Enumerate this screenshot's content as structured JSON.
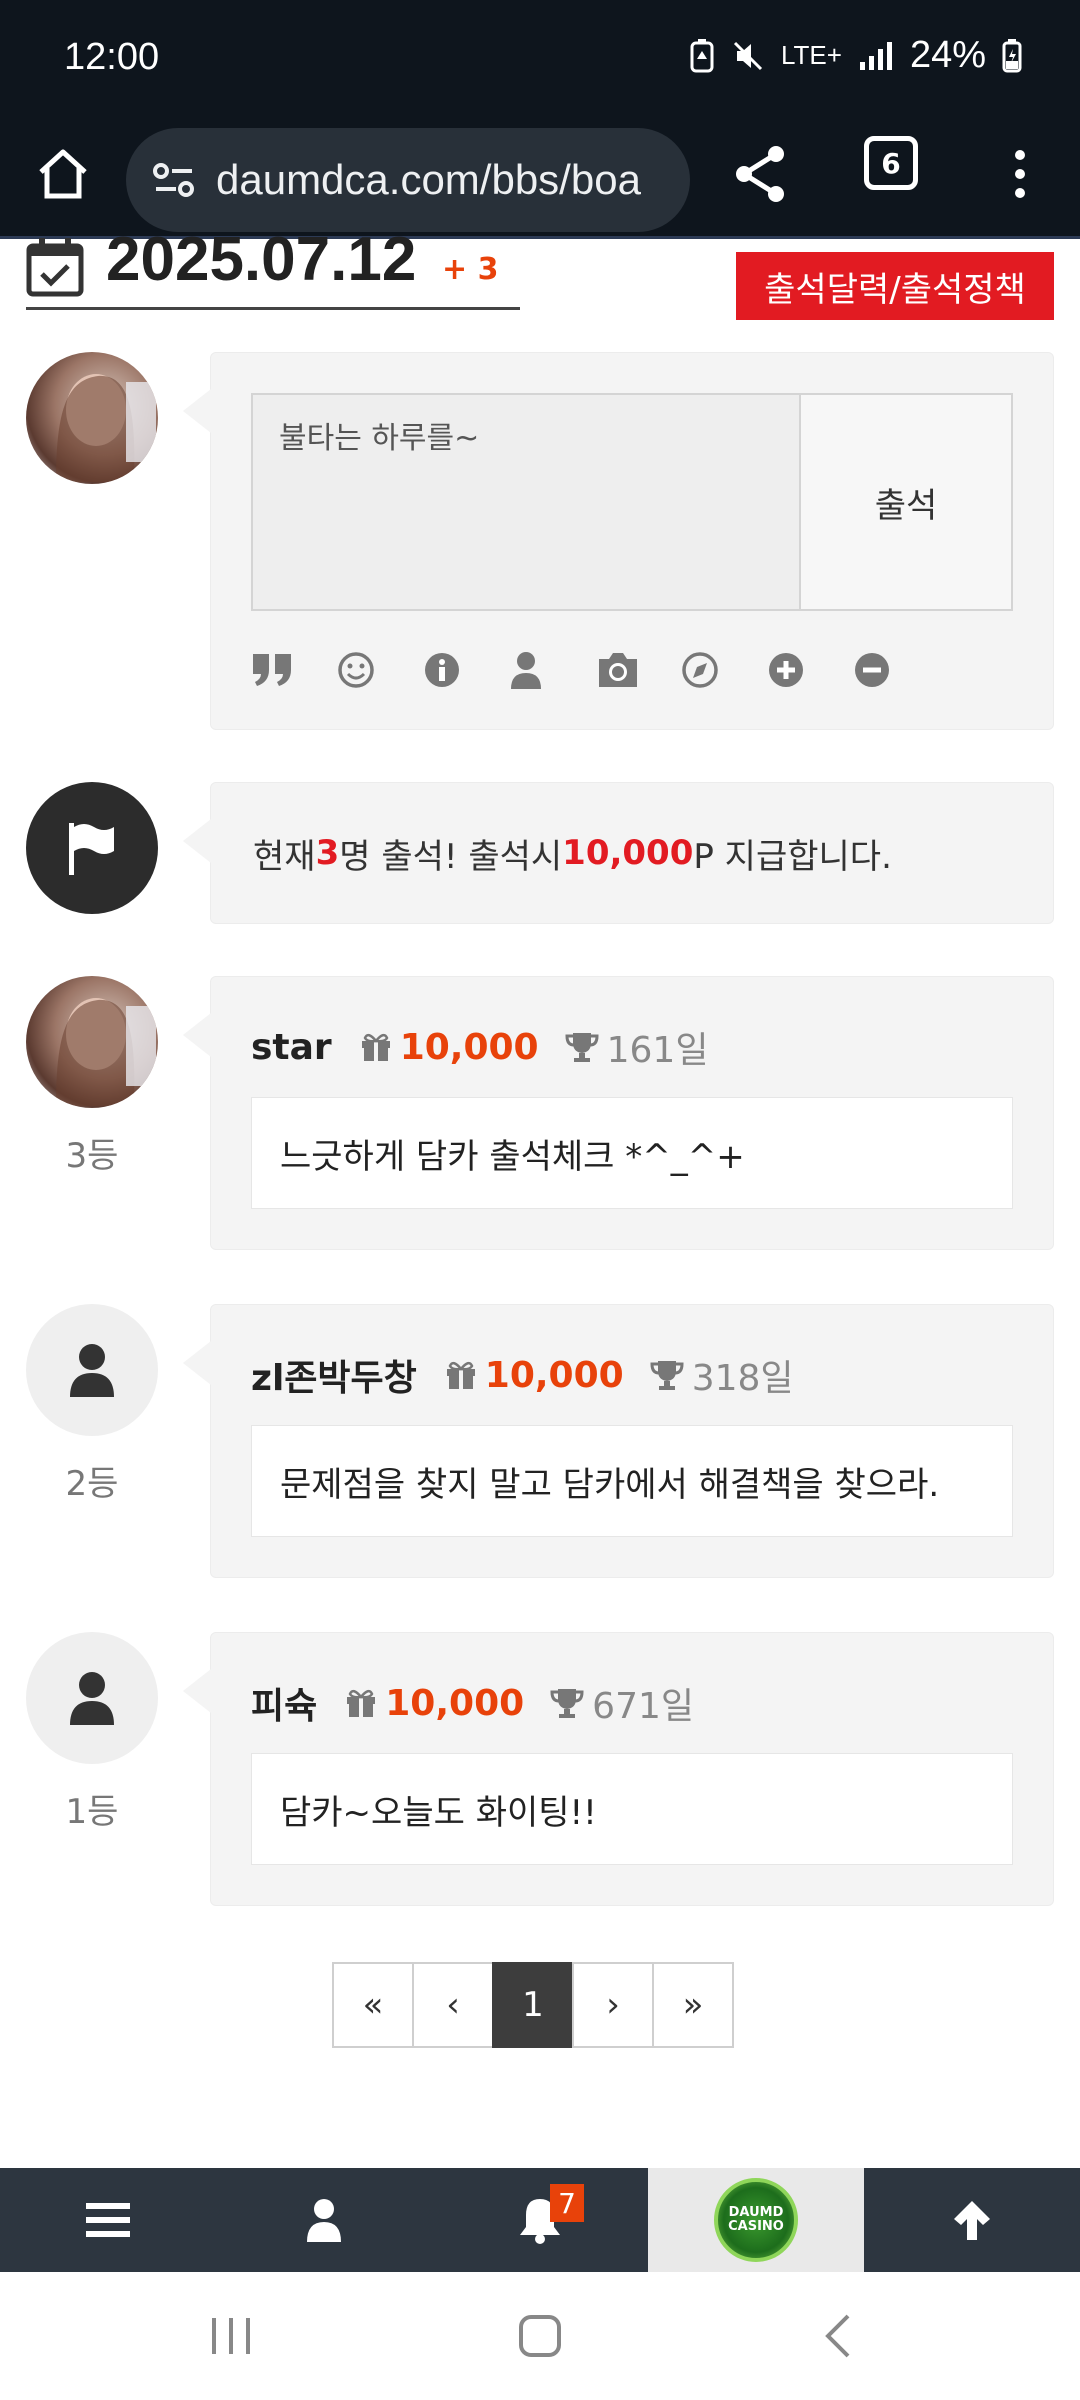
{
  "status_bar": {
    "time": "12:00",
    "network": "LTE+",
    "battery": "24%"
  },
  "browser": {
    "url": "daumdca.com/bbs/boa",
    "tab_count": "6"
  },
  "header": {
    "date": "2025.07.12",
    "count_delta": "+ 3",
    "calendar_button": "출석달력/출석정책"
  },
  "compose": {
    "placeholder": "불타는 하루를~",
    "submit_label": "출석"
  },
  "notice": {
    "pre": "현재 ",
    "count": "3",
    "mid": "명 출석! 출석시 ",
    "points": "10,000",
    "post": "P 지급합니다."
  },
  "entries": [
    {
      "rank": "3등",
      "username": "star",
      "points": "10,000",
      "days": "161일",
      "comment": "느긋하게 담카 출석체크 *^_^+"
    },
    {
      "rank": "2등",
      "username": "zl존박두창",
      "points": "10,000",
      "days": "318일",
      "comment": "문제점을 찾지 말고 담카에서 해결책을 찾으라."
    },
    {
      "rank": "1등",
      "username": "피슉",
      "points": "10,000",
      "days": "671일",
      "comment": "담카~오늘도 화이팅!!"
    }
  ],
  "pagination": {
    "first": "«",
    "prev": "‹",
    "current": "1",
    "next": "›",
    "last": "»"
  },
  "bottom_nav": {
    "notification_count": "7",
    "logo_text_line1": "DAUMD",
    "logo_text_line2": "CASINO"
  },
  "colors": {
    "accent_red": "#e21b22",
    "points_orange": "#e8420a",
    "dark_bar": "#0e151d",
    "nav_bar": "#2d3640"
  }
}
